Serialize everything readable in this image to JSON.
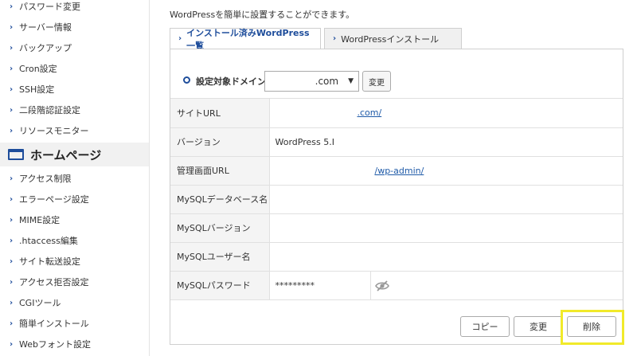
{
  "sidebar": {
    "items_top": [
      {
        "label": "パスワード変更"
      },
      {
        "label": "サーバー情報"
      },
      {
        "label": "バックアップ"
      },
      {
        "label": "Cron設定"
      },
      {
        "label": "SSH設定"
      },
      {
        "label": "二段階認証設定"
      },
      {
        "label": "リソースモニター"
      }
    ],
    "section_title": "ホームページ",
    "items_bottom": [
      {
        "label": "アクセス制限"
      },
      {
        "label": "エラーページ設定"
      },
      {
        "label": "MIME設定"
      },
      {
        "label": ".htaccess編集"
      },
      {
        "label": "サイト転送設定"
      },
      {
        "label": "アクセス拒否設定"
      },
      {
        "label": "CGIツール"
      },
      {
        "label": "簡単インストール"
      },
      {
        "label": "Webフォント設定"
      }
    ]
  },
  "main": {
    "description": "WordPressを簡単に設置することができます。",
    "tabs": [
      {
        "label": "インストール済みWordPress一覧"
      },
      {
        "label": "WordPressインストール"
      }
    ],
    "domain": {
      "label": "設定対象ドメイン",
      "selected": ".com",
      "change_label": "変更"
    },
    "rows": [
      {
        "label": "サイトURL",
        "value": ".com/"
      },
      {
        "label": "バージョン",
        "value": "WordPress 5.I"
      },
      {
        "label": "管理画面URL",
        "value": "/wp-admin/"
      },
      {
        "label": "MySQLデータベース名",
        "value": ""
      },
      {
        "label": "MySQLバージョン",
        "value": ""
      },
      {
        "label": "MySQLユーザー名",
        "value": ""
      },
      {
        "label": "MySQLパスワード",
        "value": "*********"
      }
    ],
    "buttons": {
      "copy": "コピー",
      "change": "変更",
      "delete": "削除"
    }
  },
  "colors": {
    "accent": "#1e4d9b",
    "link": "#1e5aa8",
    "highlight": "#f1ea2a"
  }
}
